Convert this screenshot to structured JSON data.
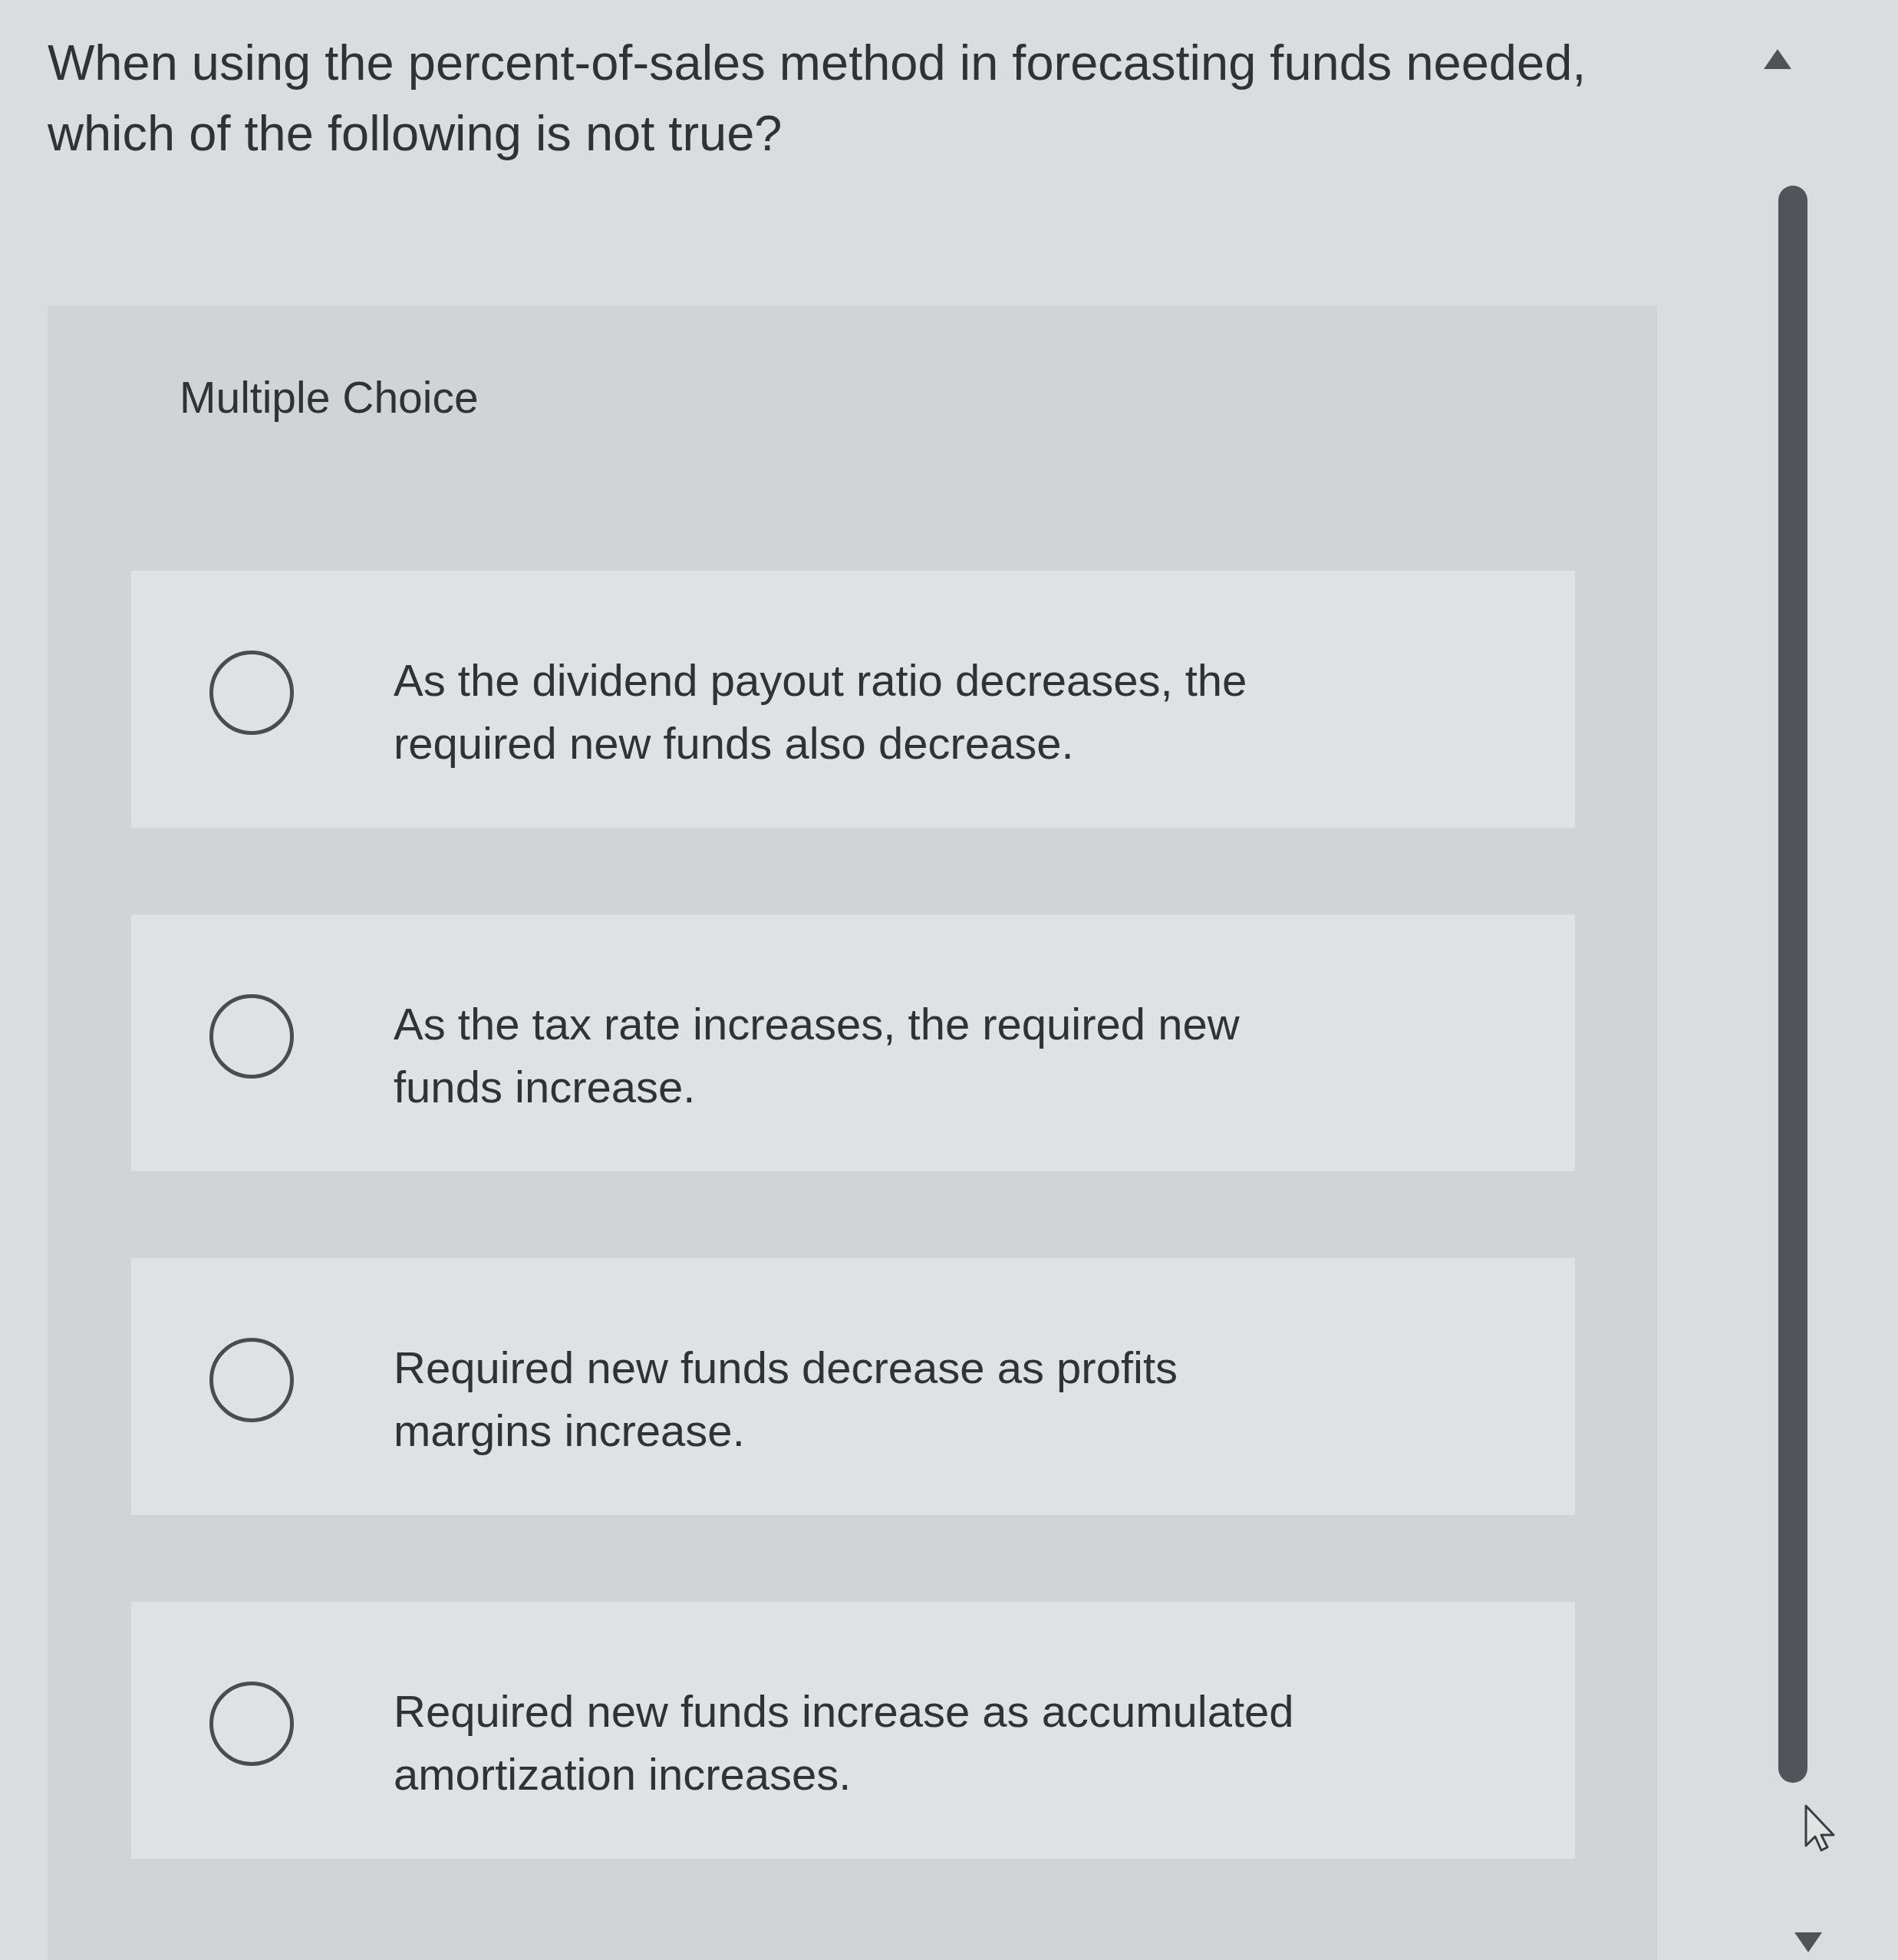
{
  "question": {
    "text": "When using the percent-of-sales method in forecasting funds needed, which of the following is not true?"
  },
  "answer_panel": {
    "title": "Multiple Choice",
    "options": [
      {
        "text": "As the dividend payout ratio decreases, the required new funds also decrease.",
        "selected": false
      },
      {
        "text": "As the tax rate increases, the required new funds increase.",
        "selected": false
      },
      {
        "text": "Required new funds decrease as profits margins increase.",
        "selected": false
      },
      {
        "text": "Required new funds increase as accumulated amortization increases.",
        "selected": false
      }
    ]
  }
}
